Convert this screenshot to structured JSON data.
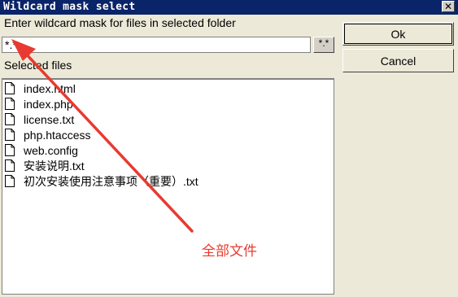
{
  "window": {
    "title": "Wildcard mask select",
    "close_glyph": "✕"
  },
  "prompt_label": "Enter wildcard mask for files in selected folder",
  "mask": {
    "value": "*.*",
    "button_label": "*.*"
  },
  "selected_files_label": "Selected files",
  "buttons": {
    "ok": "Ok",
    "cancel": "Cancel"
  },
  "files": [
    "index.html",
    "index.php",
    "license.txt",
    "php.htaccess",
    "web.config",
    "安装说明.txt",
    "初次安装使用注意事项（重要）.txt"
  ],
  "annotation": {
    "text": "全部文件",
    "color": "#e83a30"
  }
}
